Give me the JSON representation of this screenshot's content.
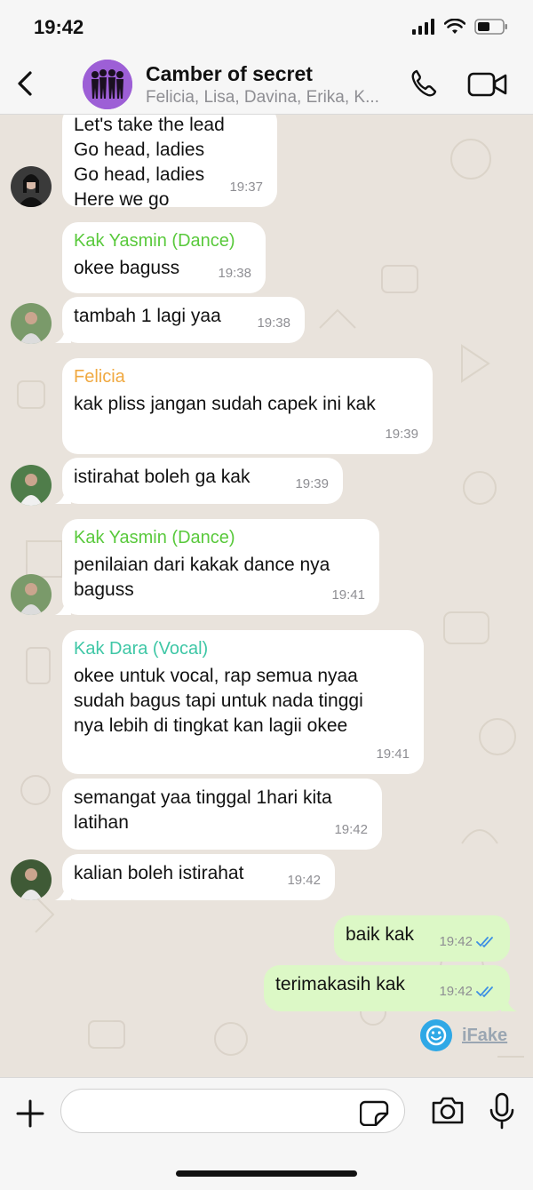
{
  "status": {
    "time": "19:42"
  },
  "header": {
    "title": "Camber of secret",
    "subtitle": "Felicia, Lisa, Davina, Erika, K..."
  },
  "messages": [
    {
      "text": "Let's take the lead\nGo head, ladies\nGo head, ladies\nHere we go",
      "time": "19:37"
    },
    {
      "sender": "Kak Yasmin (Dance)",
      "text": "okee baguss",
      "time": "19:38"
    },
    {
      "text": "tambah 1 lagi yaa",
      "time": "19:38"
    },
    {
      "sender": "Felicia",
      "text": "kak pliss jangan sudah capek ini kak",
      "time": "19:39"
    },
    {
      "text": "istirahat boleh ga kak",
      "time": "19:39"
    },
    {
      "sender": "Kak Yasmin (Dance)",
      "text": "penilaian dari kakak dance nya\nbaguss",
      "time": "19:41"
    },
    {
      "sender": "Kak Dara (Vocal)",
      "text": "okee untuk vocal, rap semua nyaa\nsudah bagus tapi untuk nada tinggi\nnya lebih di tingkat kan lagii okee",
      "time": "19:41"
    },
    {
      "text": "semangat yaa tinggal 1hari kita\nlatihan",
      "time": "19:42"
    },
    {
      "text": "kalian boleh istirahat",
      "time": "19:42"
    },
    {
      "text": "baik kak",
      "time": "19:42"
    },
    {
      "text": "terimakasih kak",
      "time": "19:42"
    }
  ],
  "watermark": {
    "label": "iFake"
  },
  "colors": {
    "yasmin": "#59c93c",
    "felicia": "#f0a941",
    "dara": "#3fc7a6",
    "read_ticks": "#3d8fe4"
  },
  "input": {
    "placeholder": ""
  }
}
